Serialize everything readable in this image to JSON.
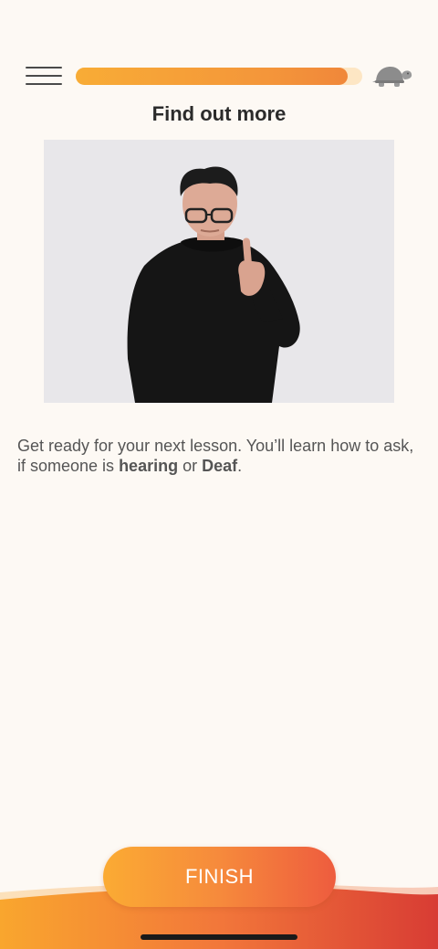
{
  "header": {
    "progress": 0.95,
    "menu_icon": "hamburger-menu-icon",
    "slow_icon": "turtle-icon"
  },
  "lesson": {
    "title": "Find out more",
    "video_alt": "Person signing",
    "description_parts": [
      "Get ready for your next lesson. You’ll learn how to ask, if someone is ",
      "hearing",
      " or ",
      "Deaf",
      "."
    ]
  },
  "footer": {
    "finish_label": "FINISH"
  },
  "colors": {
    "background": "#fdf9f4",
    "accent_start": "#fbab33",
    "accent_end": "#ee5c3e",
    "text": "#555555",
    "title": "#2b2b2b"
  }
}
